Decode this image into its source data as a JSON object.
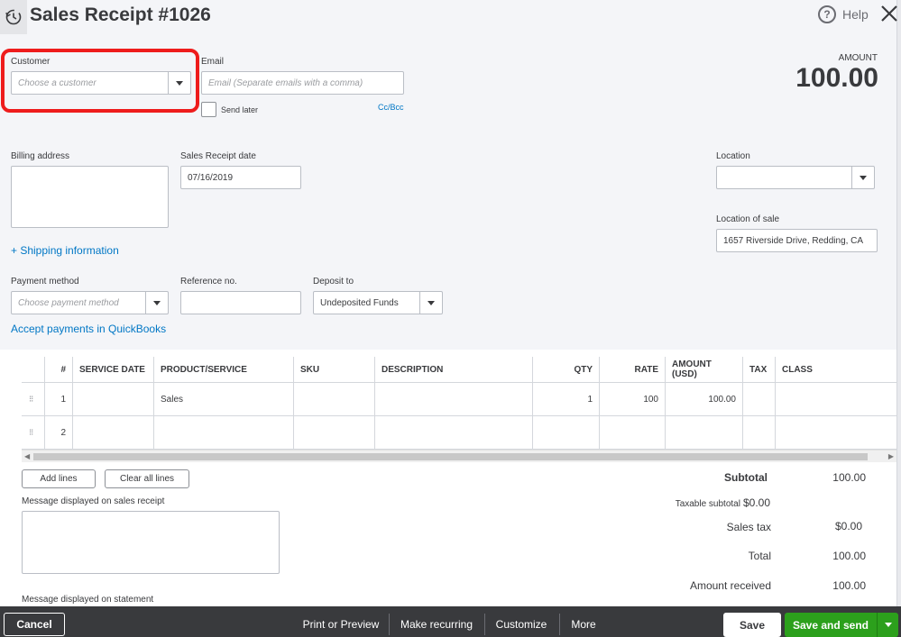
{
  "header": {
    "title": "Sales Receipt #1026",
    "help_label": "Help"
  },
  "customer": {
    "label": "Customer",
    "placeholder": "Choose a customer"
  },
  "email": {
    "label": "Email",
    "placeholder": "Email (Separate emails with a comma)",
    "send_later": "Send later",
    "cc_bcc": "Cc/Bcc"
  },
  "amount": {
    "label": "AMOUNT",
    "value": "100.00"
  },
  "billing": {
    "label": "Billing address",
    "shipping_link": "+ Shipping information"
  },
  "receipt_date": {
    "label": "Sales Receipt date",
    "value": "07/16/2019"
  },
  "location": {
    "label": "Location",
    "value": ""
  },
  "location_of_sale": {
    "label": "Location of sale",
    "value": "1657 Riverside Drive, Redding, CA"
  },
  "payment_method": {
    "label": "Payment method",
    "placeholder": "Choose payment method",
    "accept_link": "Accept payments in QuickBooks"
  },
  "reference": {
    "label": "Reference no.",
    "value": ""
  },
  "deposit": {
    "label": "Deposit to",
    "value": "Undeposited Funds"
  },
  "table": {
    "headers": [
      "#",
      "SERVICE DATE",
      "PRODUCT/SERVICE",
      "SKU",
      "DESCRIPTION",
      "QTY",
      "RATE",
      "AMOUNT (USD)",
      "TAX",
      "CLASS"
    ],
    "rows": [
      {
        "num": "1",
        "service_date": "",
        "product": "Sales",
        "sku": "",
        "description": "",
        "qty": "1",
        "rate": "100",
        "amount": "100.00",
        "tax": "",
        "class": ""
      },
      {
        "num": "2",
        "service_date": "",
        "product": "",
        "sku": "",
        "description": "",
        "qty": "",
        "rate": "",
        "amount": "",
        "tax": "",
        "class": ""
      }
    ]
  },
  "buttons": {
    "add_lines": "Add lines",
    "clear_lines": "Clear all lines"
  },
  "messages": {
    "receipt_label": "Message displayed on sales receipt",
    "statement_label": "Message displayed on statement"
  },
  "totals": {
    "subtotal_label": "Subtotal",
    "subtotal": "100.00",
    "taxable_subtotal_label": "Taxable subtotal",
    "taxable_subtotal": "$0.00",
    "sales_tax_label": "Sales tax",
    "sales_tax": "$0.00",
    "total_label": "Total",
    "total": "100.00",
    "amount_received_label": "Amount received",
    "amount_received": "100.00"
  },
  "footer": {
    "cancel": "Cancel",
    "print_preview": "Print or Preview",
    "make_recurring": "Make recurring",
    "customize": "Customize",
    "more": "More",
    "save": "Save",
    "save_send": "Save and send"
  },
  "colors": {
    "accent_green": "#2ca01c",
    "link_blue": "#0077c5",
    "highlight_red": "#ee1c1c",
    "footer_bg": "#393a3d"
  }
}
